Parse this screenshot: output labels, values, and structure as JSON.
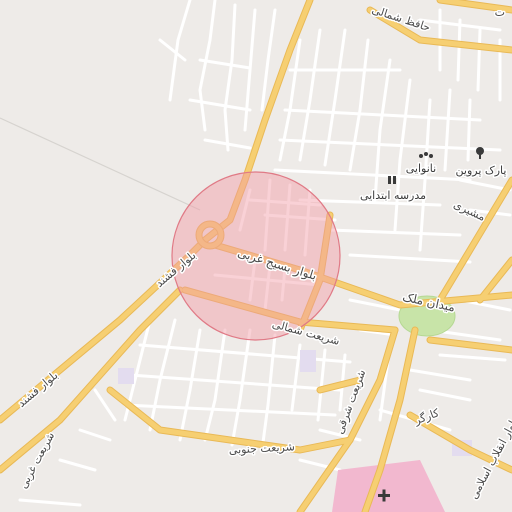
{
  "map": {
    "highlight_color": "#f29aa4",
    "road_major_color": "#f6cf72",
    "road_minor_color": "#ffffff",
    "park_color": "#c8e4a8",
    "hospital_color": "#f2b8cf",
    "background_color": "#eeebe8"
  },
  "labels": {
    "hafez_shomali": "حافظ شمالی",
    "top_right_cut": "ت",
    "park_parvin": "پارک پروین",
    "nanvaei": "نانوایی",
    "madrese": "مدرسه ابتدایی",
    "moshiri": "مشیری",
    "blvd_basij": "بلوار بسیج غربی",
    "blvd_fashand_upper": "بلوار فشند",
    "blvd_fashand_lower": "بلوار فشند",
    "meydan_malek": "میدان ملک",
    "shariati_shomali": "شریعت شمالی",
    "shariati_sharghi": "شریعت شرقی",
    "shariati_jonoubi": "شریعت جنوبی",
    "shariati_gharbi": "شریعت غربی",
    "kargar": "کارگر",
    "blvd_enghelab": "بلوار انقلاب اسلامی"
  },
  "icons": {
    "park": "tree-icon",
    "bakery": "bakery-icon",
    "school": "school-icon",
    "hospital": "hospital-cross-icon"
  }
}
